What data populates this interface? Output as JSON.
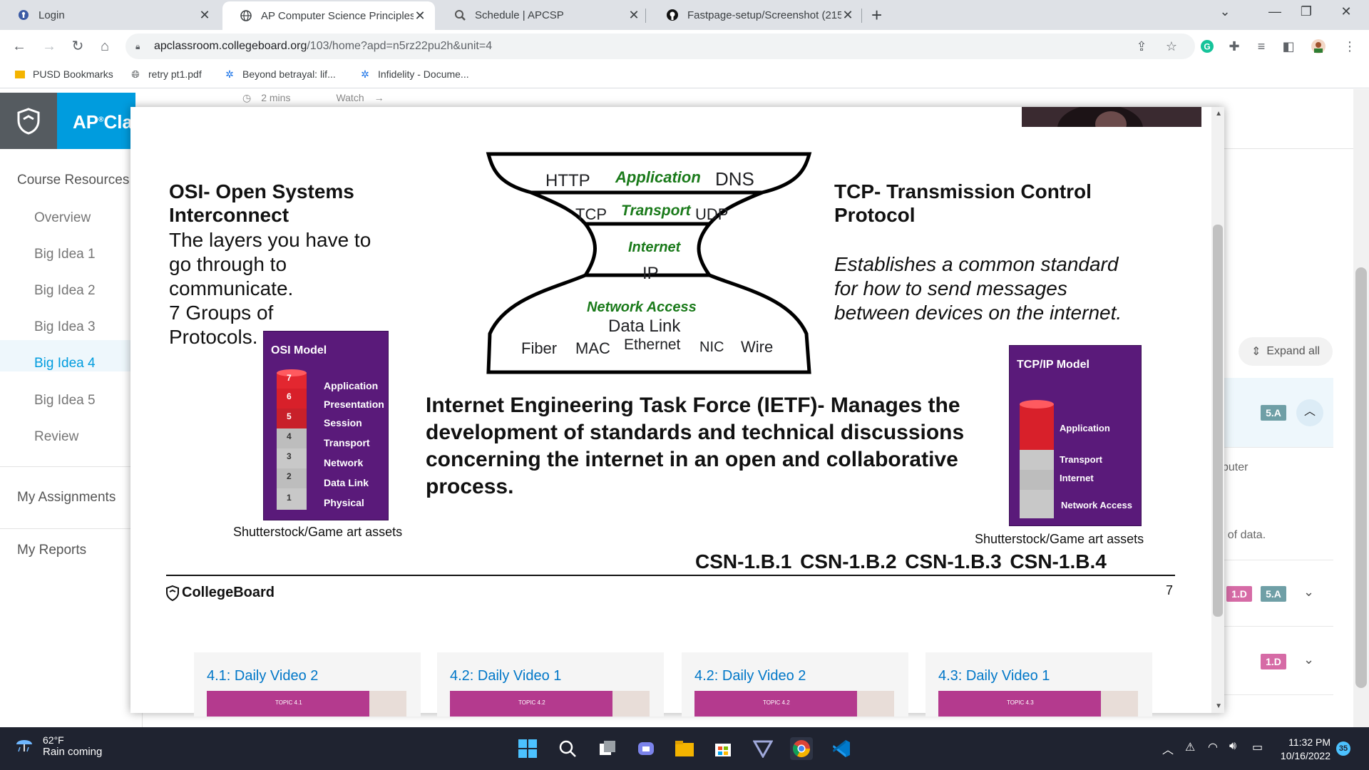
{
  "browser": {
    "tabs": [
      {
        "title": "Login",
        "active": false
      },
      {
        "title": "AP Computer Science Principles",
        "active": true
      },
      {
        "title": "Schedule | APCSP",
        "active": false
      },
      {
        "title": "Fastpage-setup/Screenshot (215)",
        "active": false
      }
    ],
    "url_host": "apclassroom.collegeboard.org",
    "url_path": "/103/home?apd=n5rz22pu2h&unit=4",
    "bookmarks": [
      "PUSD Bookmarks",
      "retry pt1.pdf",
      "Beyond betrayal: lif...",
      "Infidelity - Docume..."
    ]
  },
  "app": {
    "brand": "AP",
    "brand_suffix": "Cla",
    "top_strip": {
      "duration": "2 mins",
      "watch": "Watch"
    },
    "sidebar": {
      "section": "Course Resources",
      "items": [
        "Overview",
        "Big Idea 1",
        "Big Idea 2",
        "Big Idea 3",
        "Big Idea 4",
        "Big Idea 5",
        "Review"
      ],
      "active_index": 4,
      "my_assignments": "My Assignments",
      "my_reports": "My Reports"
    },
    "right_panel": {
      "expand_all": "Expand all",
      "rows": [
        {
          "badges": [
            "5.A"
          ],
          "text": "",
          "chevron": "up"
        },
        {
          "badges": [],
          "text": "puter",
          "chevron": ""
        },
        {
          "badges": [],
          "text": "r of data.",
          "chevron": ""
        },
        {
          "badges": [
            "1.D",
            "5.A"
          ],
          "text": "",
          "chevron": "down"
        },
        {
          "badges": [
            "1.D"
          ],
          "text": "",
          "chevron": "down"
        }
      ]
    },
    "videos": [
      {
        "title": "4.1: Daily Video 2",
        "topic": "TOPIC 4.1"
      },
      {
        "title": "4.2: Daily Video 1",
        "topic": "TOPIC 4.2"
      },
      {
        "title": "4.2: Daily Video 2",
        "topic": "TOPIC 4.2"
      },
      {
        "title": "4.3: Daily Video 1",
        "topic": "TOPIC 4.3"
      }
    ]
  },
  "slide": {
    "osi_heading": "OSI- Open Systems Interconnect",
    "osi_text_1": "The layers you have to go through to communicate.",
    "osi_text_2": "7 Groups of Protocols.",
    "tcp_heading": "TCP- Transmission Control Protocol",
    "tcp_text": "Establishes a common standard for how to send messages between devices on the internet.",
    "hourglass": {
      "application": "Application",
      "http": "HTTP",
      "dns": "DNS",
      "transport": "Transport",
      "tcp": "TCP",
      "udp": "UDP",
      "internet": "Internet",
      "ip": "IP",
      "network_access": "Network Access",
      "data_link": "Data Link",
      "fiber": "Fiber",
      "mac": "MAC",
      "ethernet": "Ethernet",
      "nic": "NIC",
      "wire": "Wire"
    },
    "osi_model": {
      "title": "OSI Model",
      "layers": [
        {
          "num": "7",
          "name": "Application"
        },
        {
          "num": "6",
          "name": "Presentation"
        },
        {
          "num": "5",
          "name": "Session"
        },
        {
          "num": "4",
          "name": "Transport"
        },
        {
          "num": "3",
          "name": "Network"
        },
        {
          "num": "2",
          "name": "Data Link"
        },
        {
          "num": "1",
          "name": "Physical"
        }
      ],
      "caption": "Shutterstock/Game art assets"
    },
    "tcpip_model": {
      "title": "TCP/IP Model",
      "layers": [
        "Application",
        "Transport",
        "Internet",
        "Network Access"
      ],
      "caption": "Shutterstock/Game art assets"
    },
    "ietf": "Internet Engineering Task Force (IETF)-  Manages the development of standards and technical discussions concerning the internet in an open and collaborative process.",
    "csn": "CSN-1.B.1   CSN-1.B.2  CSN-1.B.3 CSN-1.B.4",
    "footer_logo": "CollegeBoard",
    "page_number": "7"
  },
  "taskbar": {
    "temp": "62°F",
    "condition": "Rain coming",
    "time": "11:32 PM",
    "date": "10/16/2022",
    "notifications": "35"
  },
  "colors": {
    "accent": "#009cde",
    "slide_green": "#1a7a1a",
    "model_purple": "#5a1a7a",
    "layer_red": "#d0202a"
  }
}
